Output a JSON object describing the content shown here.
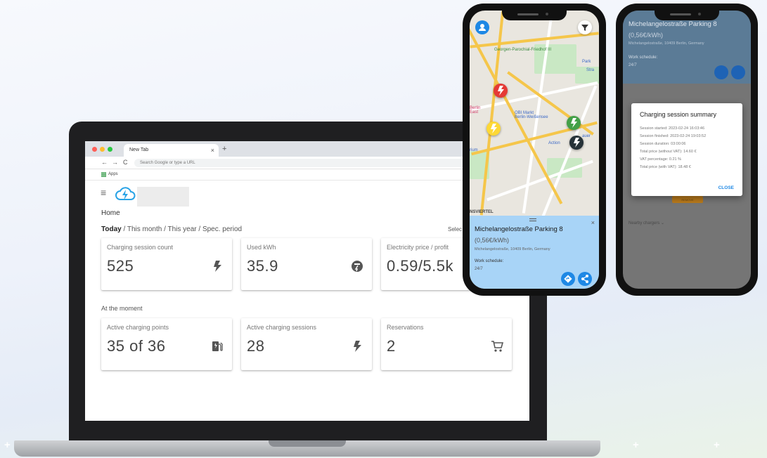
{
  "browser": {
    "tab_title": "New Tab",
    "tab_close": "×",
    "new_tab": "+",
    "nav_back": "←",
    "nav_forward": "→",
    "nav_reload": "C",
    "omnibox_placeholder": "Search Google or type a URL",
    "bookmarks_apps": "Apps"
  },
  "dashboard": {
    "menu_icon": "≡",
    "page_title": "Home",
    "period_today": "Today",
    "period_rest": " / This month / This year / Spec. period",
    "select_label": "Selec",
    "section_at_moment": "At the moment",
    "cards_top": [
      {
        "label": "Charging session count",
        "value": "525",
        "icon": "bolt-icon"
      },
      {
        "label": "Used kWh",
        "value": "35.9",
        "icon": "meter-icon"
      },
      {
        "label": "Electricity price / profit",
        "value": "0.59/5.5k",
        "icon": "none"
      }
    ],
    "cards_bottom": [
      {
        "label": "Active charging points",
        "value": "35 of 36",
        "icon": "ev-station-icon"
      },
      {
        "label": "Active charging sessions",
        "value": "28",
        "icon": "bolt-icon"
      },
      {
        "label": "Reservations",
        "value": "2",
        "icon": "cart-icon"
      }
    ]
  },
  "phone_map": {
    "map_labels": {
      "friedhof": "Georgen-Parochial-Friedhof III",
      "obi": "OBI Markt\nBerlin-Weißensee",
      "action": "Action",
      "berlin_east": "Berlin\nEast",
      "quarter": "NSVIERTEL",
      "park": "Park",
      "strasse": "Stra",
      "rium": "rium",
      "auer": "auer"
    },
    "station": {
      "title": "Michelangelostraße Parking 8",
      "price": "(0,56€/kWh)",
      "address": "Michelangelostraße, 10409 Berlin, Germany",
      "schedule_label": "Work schedule:",
      "schedule_value": "24/7",
      "close": "×"
    },
    "colors": {
      "sheet": "#a8d4f7",
      "accent": "#1e88e5",
      "pin_red": "#e53935",
      "pin_yellow": "#fdd835",
      "pin_green": "#43a047",
      "pin_dark": "#263238"
    }
  },
  "phone_summary": {
    "header_title": "Michelangelostraße Parking 8",
    "header_price": "(0,56€/kWh)",
    "header_address": "Michelangelostraße, 10409 Berlin, Germany",
    "schedule_label": "Work schedule:",
    "schedule_value": "24/7",
    "nearby": "Nearby chargers ⌄",
    "dialog": {
      "title": "Charging session summary",
      "lines": [
        "Session started: 2023-02-24 16:03:46",
        "Session finished: 2023-02-24 19:03:52",
        "Session duration: 03:00:06",
        "Total price (without VAT): 14.60 €",
        "VAT percentage: 0.21 %",
        "Total price (with VAT): 18.48 €"
      ],
      "close": "CLOSE"
    },
    "orange_button": "REMOVE"
  }
}
